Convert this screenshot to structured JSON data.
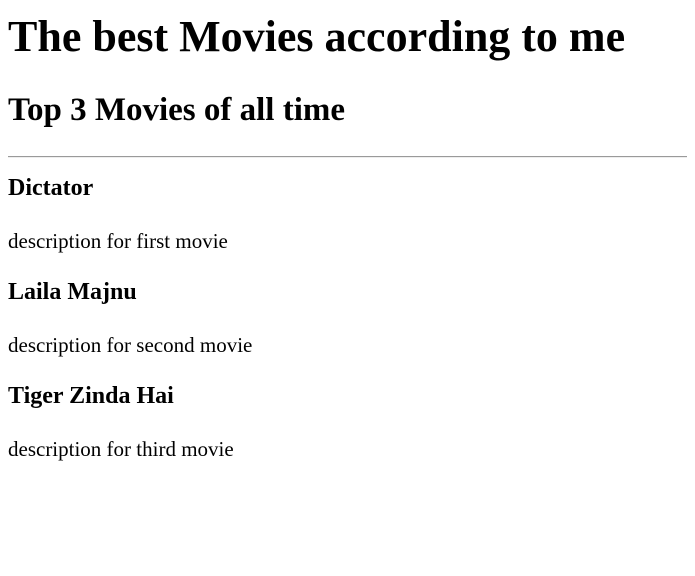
{
  "page": {
    "title": "The best Movies according to me",
    "subtitle": "Top 3 Movies of all time"
  },
  "movies": [
    {
      "name": "Dictator",
      "description": "description for first movie"
    },
    {
      "name": "Laila Majnu",
      "description": "description for second movie"
    },
    {
      "name": "Tiger Zinda Hai",
      "description": "description for third movie"
    }
  ]
}
